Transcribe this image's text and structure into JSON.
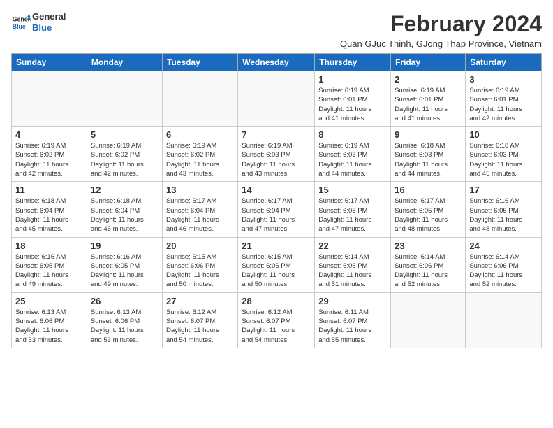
{
  "logo": {
    "general": "General",
    "blue": "Blue"
  },
  "title": {
    "month_year": "February 2024",
    "location": "Quan GJuc Thinh, GJong Thap Province, Vietnam"
  },
  "weekdays": [
    "Sunday",
    "Monday",
    "Tuesday",
    "Wednesday",
    "Thursday",
    "Friday",
    "Saturday"
  ],
  "weeks": [
    [
      {
        "day": "",
        "info": ""
      },
      {
        "day": "",
        "info": ""
      },
      {
        "day": "",
        "info": ""
      },
      {
        "day": "",
        "info": ""
      },
      {
        "day": "1",
        "info": "Sunrise: 6:19 AM\nSunset: 6:01 PM\nDaylight: 11 hours\nand 41 minutes."
      },
      {
        "day": "2",
        "info": "Sunrise: 6:19 AM\nSunset: 6:01 PM\nDaylight: 11 hours\nand 41 minutes."
      },
      {
        "day": "3",
        "info": "Sunrise: 6:19 AM\nSunset: 6:01 PM\nDaylight: 11 hours\nand 42 minutes."
      }
    ],
    [
      {
        "day": "4",
        "info": "Sunrise: 6:19 AM\nSunset: 6:02 PM\nDaylight: 11 hours\nand 42 minutes."
      },
      {
        "day": "5",
        "info": "Sunrise: 6:19 AM\nSunset: 6:02 PM\nDaylight: 11 hours\nand 42 minutes."
      },
      {
        "day": "6",
        "info": "Sunrise: 6:19 AM\nSunset: 6:02 PM\nDaylight: 11 hours\nand 43 minutes."
      },
      {
        "day": "7",
        "info": "Sunrise: 6:19 AM\nSunset: 6:03 PM\nDaylight: 11 hours\nand 43 minutes."
      },
      {
        "day": "8",
        "info": "Sunrise: 6:19 AM\nSunset: 6:03 PM\nDaylight: 11 hours\nand 44 minutes."
      },
      {
        "day": "9",
        "info": "Sunrise: 6:18 AM\nSunset: 6:03 PM\nDaylight: 11 hours\nand 44 minutes."
      },
      {
        "day": "10",
        "info": "Sunrise: 6:18 AM\nSunset: 6:03 PM\nDaylight: 11 hours\nand 45 minutes."
      }
    ],
    [
      {
        "day": "11",
        "info": "Sunrise: 6:18 AM\nSunset: 6:04 PM\nDaylight: 11 hours\nand 45 minutes."
      },
      {
        "day": "12",
        "info": "Sunrise: 6:18 AM\nSunset: 6:04 PM\nDaylight: 11 hours\nand 46 minutes."
      },
      {
        "day": "13",
        "info": "Sunrise: 6:17 AM\nSunset: 6:04 PM\nDaylight: 11 hours\nand 46 minutes."
      },
      {
        "day": "14",
        "info": "Sunrise: 6:17 AM\nSunset: 6:04 PM\nDaylight: 11 hours\nand 47 minutes."
      },
      {
        "day": "15",
        "info": "Sunrise: 6:17 AM\nSunset: 6:05 PM\nDaylight: 11 hours\nand 47 minutes."
      },
      {
        "day": "16",
        "info": "Sunrise: 6:17 AM\nSunset: 6:05 PM\nDaylight: 11 hours\nand 48 minutes."
      },
      {
        "day": "17",
        "info": "Sunrise: 6:16 AM\nSunset: 6:05 PM\nDaylight: 11 hours\nand 48 minutes."
      }
    ],
    [
      {
        "day": "18",
        "info": "Sunrise: 6:16 AM\nSunset: 6:05 PM\nDaylight: 11 hours\nand 49 minutes."
      },
      {
        "day": "19",
        "info": "Sunrise: 6:16 AM\nSunset: 6:05 PM\nDaylight: 11 hours\nand 49 minutes."
      },
      {
        "day": "20",
        "info": "Sunrise: 6:15 AM\nSunset: 6:06 PM\nDaylight: 11 hours\nand 50 minutes."
      },
      {
        "day": "21",
        "info": "Sunrise: 6:15 AM\nSunset: 6:06 PM\nDaylight: 11 hours\nand 50 minutes."
      },
      {
        "day": "22",
        "info": "Sunrise: 6:14 AM\nSunset: 6:06 PM\nDaylight: 11 hours\nand 51 minutes."
      },
      {
        "day": "23",
        "info": "Sunrise: 6:14 AM\nSunset: 6:06 PM\nDaylight: 11 hours\nand 52 minutes."
      },
      {
        "day": "24",
        "info": "Sunrise: 6:14 AM\nSunset: 6:06 PM\nDaylight: 11 hours\nand 52 minutes."
      }
    ],
    [
      {
        "day": "25",
        "info": "Sunrise: 6:13 AM\nSunset: 6:06 PM\nDaylight: 11 hours\nand 53 minutes."
      },
      {
        "day": "26",
        "info": "Sunrise: 6:13 AM\nSunset: 6:06 PM\nDaylight: 11 hours\nand 53 minutes."
      },
      {
        "day": "27",
        "info": "Sunrise: 6:12 AM\nSunset: 6:07 PM\nDaylight: 11 hours\nand 54 minutes."
      },
      {
        "day": "28",
        "info": "Sunrise: 6:12 AM\nSunset: 6:07 PM\nDaylight: 11 hours\nand 54 minutes."
      },
      {
        "day": "29",
        "info": "Sunrise: 6:11 AM\nSunset: 6:07 PM\nDaylight: 11 hours\nand 55 minutes."
      },
      {
        "day": "",
        "info": ""
      },
      {
        "day": "",
        "info": ""
      }
    ]
  ]
}
